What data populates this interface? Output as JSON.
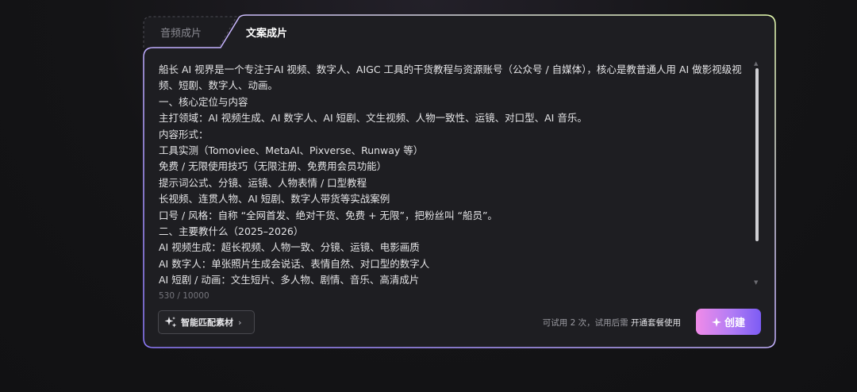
{
  "tabs": [
    {
      "label": "音频成片",
      "active": false
    },
    {
      "label": "文案成片",
      "active": true
    }
  ],
  "editor": {
    "lines": [
      "船长 AI 视界是一个专注于AI 视频、数字人、AIGC 工具的干货教程与资源账号（公众号 / 自媒体），核心是教普通人用 AI 做影视级视频、短剧、数字人、动画。",
      "一、核心定位与内容",
      "主打领域：AI 视频生成、AI 数字人、AI 短剧、文生视频、人物一致性、运镜、对口型、AI 音乐。",
      "内容形式：",
      "工具实测（Tomoviee、MetaAI、Pixverse、Runway 等）",
      "免费 / 无限使用技巧（无限注册、免费用会员功能）",
      "提示词公式、分镜、运镜、人物表情 / 口型教程",
      "长视频、连贯人物、AI 短剧、数字人带货等实战案例",
      "口号 / 风格：自称 “全网首发、绝对干货、免费 + 无限”，把粉丝叫 “船员”。",
      "二、主要教什么（2025–2026）",
      "AI 视频生成：超长视频、人物一致、分镜、运镜、电影画质",
      "AI 数字人：单张照片生成会说话、表情自然、对口型的数字人",
      "AI 短剧 / 动画：文生短片、多人物、剧情、音乐、高清成片"
    ],
    "counter": "530 / 10000"
  },
  "footer": {
    "smart_match_label": "智能匹配素材",
    "trial_text": "可试用 2 次，试用后需",
    "trial_link": "开通套餐使用",
    "create_label": "创建"
  },
  "colors": {
    "border_gradient": [
      "#8f7bff",
      "#c9b7ff",
      "#e7ffb0"
    ],
    "create_gradient": [
      "#f08be8",
      "#b27cf5",
      "#7c5cf4"
    ]
  },
  "icons": {
    "sparkle": "sparkle-icon",
    "chevron": "chevron-right-icon"
  }
}
